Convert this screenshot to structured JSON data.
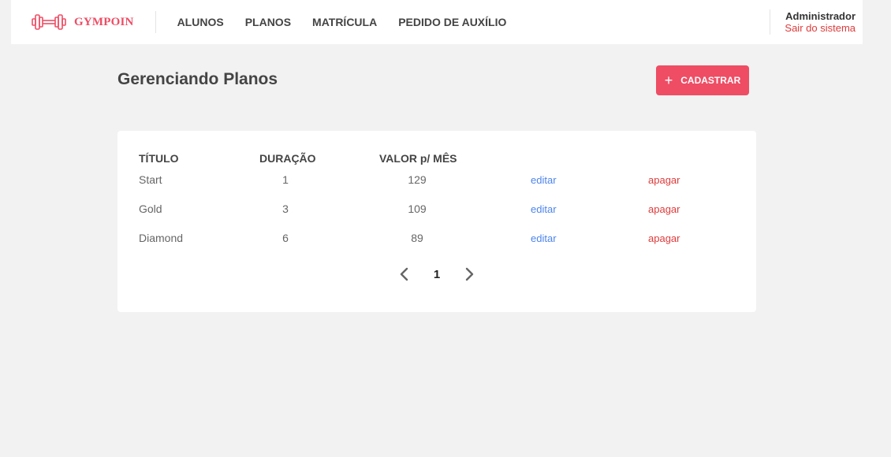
{
  "header": {
    "brand": "GYMPOIN",
    "nav": [
      "ALUNOS",
      "PLANOS",
      "MATRÍCULA",
      "PEDIDO DE AUXÍLIO"
    ],
    "user_name": "Administrador",
    "logout_label": "Sair do sistema"
  },
  "page": {
    "title": "Gerenciando Planos",
    "add_button_label": "CADASTRAR",
    "add_button_icon": "plus-icon"
  },
  "table": {
    "headers": [
      "TÍTULO",
      "DURAÇÃO",
      "VALOR p/ MÊS"
    ],
    "rows": [
      {
        "title": "Start",
        "duration": "1",
        "value": "129",
        "edit": "editar",
        "delete": "apagar"
      },
      {
        "title": "Gold",
        "duration": "3",
        "value": "109",
        "edit": "editar",
        "delete": "apagar"
      },
      {
        "title": "Diamond",
        "duration": "6",
        "value": "89",
        "edit": "editar",
        "delete": "apagar"
      }
    ]
  },
  "pagination": {
    "current_page": "1",
    "prev_icon": "chevron-left-icon",
    "next_icon": "chevron-right-icon"
  },
  "colors": {
    "brand": "#ee4d64",
    "edit_link": "#4d85ee",
    "delete_link": "#de3b3b",
    "background": "#f2f2f2"
  }
}
